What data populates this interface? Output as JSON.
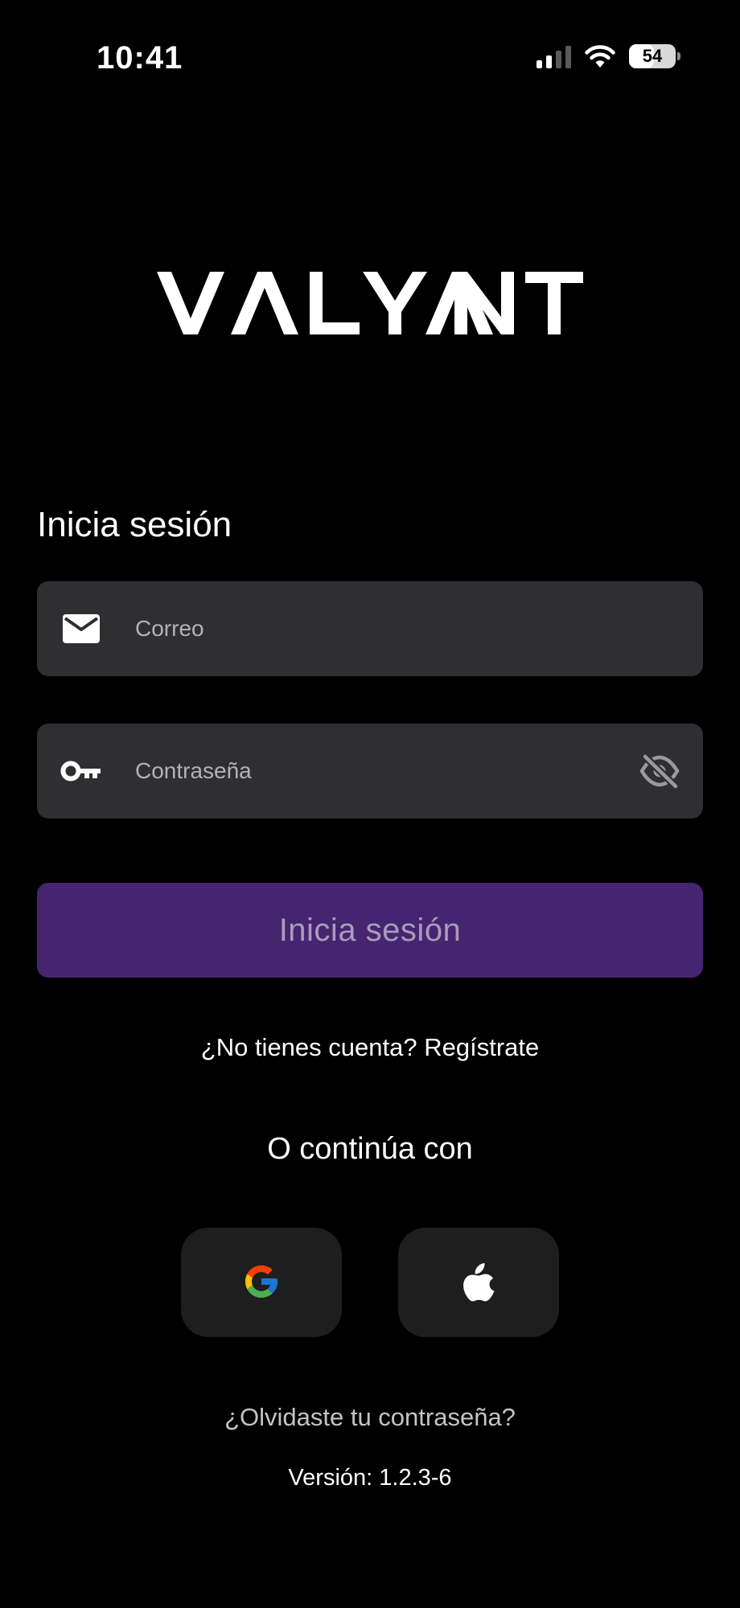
{
  "status_bar": {
    "time": "10:41",
    "battery": "54",
    "battery_level_percent": 54,
    "icons": [
      "cellular-signal-icon",
      "wifi-icon",
      "battery-icon"
    ]
  },
  "brand": {
    "logo_text": "VALYANT"
  },
  "login": {
    "title": "Inicia sesión",
    "email_placeholder": "Correo",
    "email_value": "",
    "password_placeholder": "Contraseña",
    "password_value": "",
    "submit_label": "Inicia sesión",
    "email_icon": "mail-icon",
    "password_icon": "key-icon",
    "visibility_icon": "eye-off-icon"
  },
  "register": {
    "prompt": "¿No tienes cuenta?",
    "action": "Regístrate"
  },
  "social": {
    "label": "O continúa con",
    "providers": [
      {
        "name": "Google",
        "icon": "google-icon"
      },
      {
        "name": "Apple",
        "icon": "apple-icon"
      }
    ]
  },
  "footer": {
    "forgot_password": "¿Olvidaste tu contraseña?",
    "version": "Versión: 1.2.3-6"
  },
  "colors": {
    "background": "#000000",
    "field_background": "#2f2f31",
    "button_background": "#45256f",
    "button_text": "#a99bbd",
    "social_button_background": "#1e1e1f"
  }
}
